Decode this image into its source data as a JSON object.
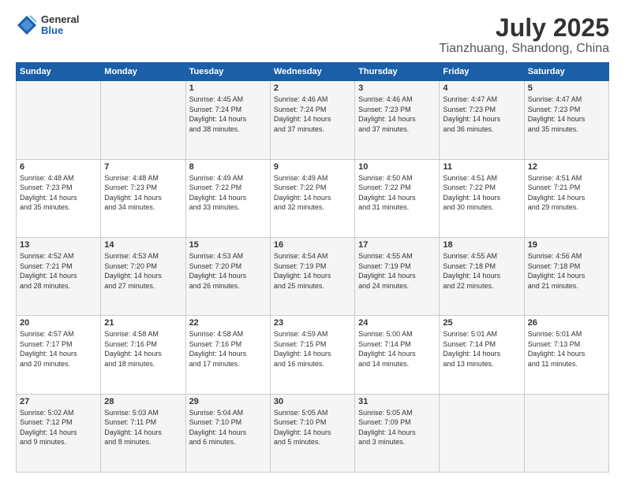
{
  "logo": {
    "general": "General",
    "blue": "Blue"
  },
  "header": {
    "month": "July 2025",
    "location": "Tianzhuang, Shandong, China"
  },
  "weekdays": [
    "Sunday",
    "Monday",
    "Tuesday",
    "Wednesday",
    "Thursday",
    "Friday",
    "Saturday"
  ],
  "weeks": [
    [
      {
        "day": "",
        "info": ""
      },
      {
        "day": "",
        "info": ""
      },
      {
        "day": "1",
        "info": "Sunrise: 4:45 AM\nSunset: 7:24 PM\nDaylight: 14 hours\nand 38 minutes."
      },
      {
        "day": "2",
        "info": "Sunrise: 4:46 AM\nSunset: 7:24 PM\nDaylight: 14 hours\nand 37 minutes."
      },
      {
        "day": "3",
        "info": "Sunrise: 4:46 AM\nSunset: 7:23 PM\nDaylight: 14 hours\nand 37 minutes."
      },
      {
        "day": "4",
        "info": "Sunrise: 4:47 AM\nSunset: 7:23 PM\nDaylight: 14 hours\nand 36 minutes."
      },
      {
        "day": "5",
        "info": "Sunrise: 4:47 AM\nSunset: 7:23 PM\nDaylight: 14 hours\nand 35 minutes."
      }
    ],
    [
      {
        "day": "6",
        "info": "Sunrise: 4:48 AM\nSunset: 7:23 PM\nDaylight: 14 hours\nand 35 minutes."
      },
      {
        "day": "7",
        "info": "Sunrise: 4:48 AM\nSunset: 7:23 PM\nDaylight: 14 hours\nand 34 minutes."
      },
      {
        "day": "8",
        "info": "Sunrise: 4:49 AM\nSunset: 7:22 PM\nDaylight: 14 hours\nand 33 minutes."
      },
      {
        "day": "9",
        "info": "Sunrise: 4:49 AM\nSunset: 7:22 PM\nDaylight: 14 hours\nand 32 minutes."
      },
      {
        "day": "10",
        "info": "Sunrise: 4:50 AM\nSunset: 7:22 PM\nDaylight: 14 hours\nand 31 minutes."
      },
      {
        "day": "11",
        "info": "Sunrise: 4:51 AM\nSunset: 7:22 PM\nDaylight: 14 hours\nand 30 minutes."
      },
      {
        "day": "12",
        "info": "Sunrise: 4:51 AM\nSunset: 7:21 PM\nDaylight: 14 hours\nand 29 minutes."
      }
    ],
    [
      {
        "day": "13",
        "info": "Sunrise: 4:52 AM\nSunset: 7:21 PM\nDaylight: 14 hours\nand 28 minutes."
      },
      {
        "day": "14",
        "info": "Sunrise: 4:53 AM\nSunset: 7:20 PM\nDaylight: 14 hours\nand 27 minutes."
      },
      {
        "day": "15",
        "info": "Sunrise: 4:53 AM\nSunset: 7:20 PM\nDaylight: 14 hours\nand 26 minutes."
      },
      {
        "day": "16",
        "info": "Sunrise: 4:54 AM\nSunset: 7:19 PM\nDaylight: 14 hours\nand 25 minutes."
      },
      {
        "day": "17",
        "info": "Sunrise: 4:55 AM\nSunset: 7:19 PM\nDaylight: 14 hours\nand 24 minutes."
      },
      {
        "day": "18",
        "info": "Sunrise: 4:55 AM\nSunset: 7:18 PM\nDaylight: 14 hours\nand 22 minutes."
      },
      {
        "day": "19",
        "info": "Sunrise: 4:56 AM\nSunset: 7:18 PM\nDaylight: 14 hours\nand 21 minutes."
      }
    ],
    [
      {
        "day": "20",
        "info": "Sunrise: 4:57 AM\nSunset: 7:17 PM\nDaylight: 14 hours\nand 20 minutes."
      },
      {
        "day": "21",
        "info": "Sunrise: 4:58 AM\nSunset: 7:16 PM\nDaylight: 14 hours\nand 18 minutes."
      },
      {
        "day": "22",
        "info": "Sunrise: 4:58 AM\nSunset: 7:16 PM\nDaylight: 14 hours\nand 17 minutes."
      },
      {
        "day": "23",
        "info": "Sunrise: 4:59 AM\nSunset: 7:15 PM\nDaylight: 14 hours\nand 16 minutes."
      },
      {
        "day": "24",
        "info": "Sunrise: 5:00 AM\nSunset: 7:14 PM\nDaylight: 14 hours\nand 14 minutes."
      },
      {
        "day": "25",
        "info": "Sunrise: 5:01 AM\nSunset: 7:14 PM\nDaylight: 14 hours\nand 13 minutes."
      },
      {
        "day": "26",
        "info": "Sunrise: 5:01 AM\nSunset: 7:13 PM\nDaylight: 14 hours\nand 11 minutes."
      }
    ],
    [
      {
        "day": "27",
        "info": "Sunrise: 5:02 AM\nSunset: 7:12 PM\nDaylight: 14 hours\nand 9 minutes."
      },
      {
        "day": "28",
        "info": "Sunrise: 5:03 AM\nSunset: 7:11 PM\nDaylight: 14 hours\nand 8 minutes."
      },
      {
        "day": "29",
        "info": "Sunrise: 5:04 AM\nSunset: 7:10 PM\nDaylight: 14 hours\nand 6 minutes."
      },
      {
        "day": "30",
        "info": "Sunrise: 5:05 AM\nSunset: 7:10 PM\nDaylight: 14 hours\nand 5 minutes."
      },
      {
        "day": "31",
        "info": "Sunrise: 5:05 AM\nSunset: 7:09 PM\nDaylight: 14 hours\nand 3 minutes."
      },
      {
        "day": "",
        "info": ""
      },
      {
        "day": "",
        "info": ""
      }
    ]
  ]
}
